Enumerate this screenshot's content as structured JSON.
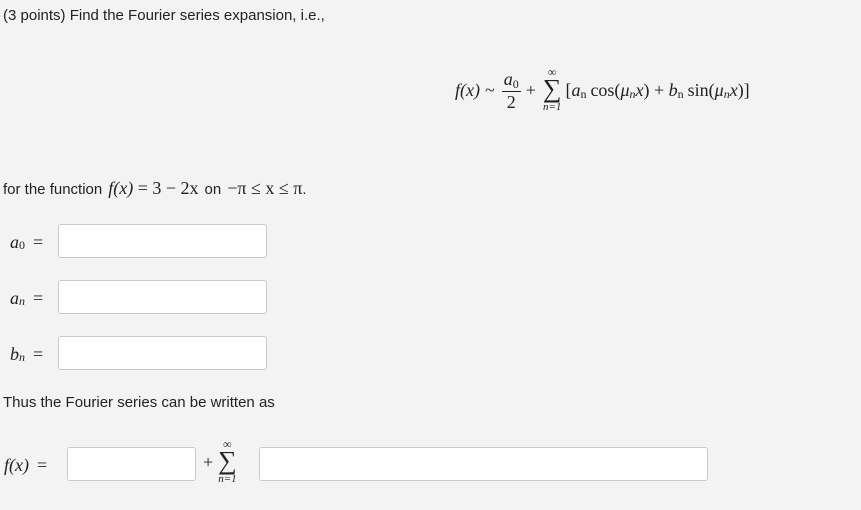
{
  "question": {
    "header": "(3 points) Find the Fourier series expansion, i.e.,",
    "intro_text": "for the function",
    "on_text": "on",
    "conclusion_text": "Thus the Fourier series can be written as"
  },
  "formula": {
    "lhs": "f(x)",
    "sim": "~",
    "a0_num": "a",
    "a0_sub": "0",
    "a0_den": "2",
    "plus": "+",
    "sum_top": "∞",
    "sum_symbol": "∑",
    "sum_bottom": "n=1",
    "bracket_open": "[",
    "an": "a",
    "an_sub": "n",
    "cos": "cos(",
    "mu": "μ",
    "mu_sub": "n",
    "x": "x",
    "close_paren": ")",
    "plus2": " + ",
    "bn": "b",
    "bn_sub": "n",
    "sin": "sin(",
    "bracket_close": ")]"
  },
  "function_def": {
    "lhs": "f(x)",
    "eq": " = ",
    "rhs": "3 − 2x",
    "domain": "−π ≤ x ≤ π",
    "period": "."
  },
  "fields": {
    "a0": {
      "label": "a",
      "sub": "0",
      "eq": "=",
      "value": ""
    },
    "an": {
      "label": "a",
      "sub": "n",
      "eq": "=",
      "value": ""
    },
    "bn": {
      "label": "b",
      "sub": "n",
      "eq": "=",
      "value": ""
    }
  },
  "series_answer": {
    "lhs": "f(x)",
    "eq": "=",
    "plus": "+",
    "sum_top": "∞",
    "sum_symbol": "∑",
    "sum_bottom": "n=1",
    "const_value": "",
    "term_value": ""
  }
}
